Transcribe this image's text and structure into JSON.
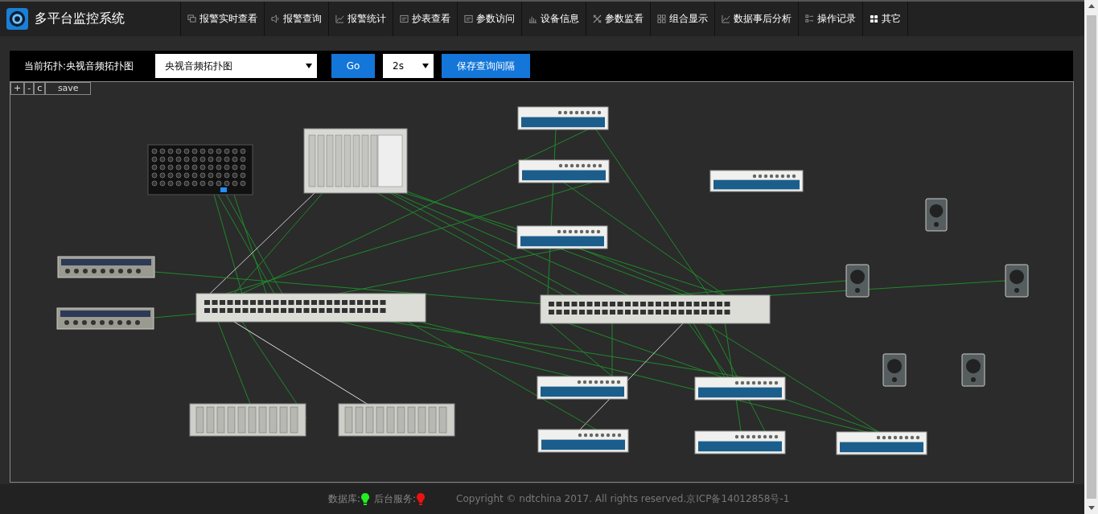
{
  "app": {
    "title": "多平台监控系统"
  },
  "nav": [
    {
      "label": "报警实时查看"
    },
    {
      "label": "报警查询"
    },
    {
      "label": "报警统计"
    },
    {
      "label": "抄表查看"
    },
    {
      "label": "参数访问"
    },
    {
      "label": "设备信息"
    },
    {
      "label": "参数监看"
    },
    {
      "label": "组合显示"
    },
    {
      "label": "数据事后分析"
    },
    {
      "label": "操作记录"
    },
    {
      "label": "其它"
    }
  ],
  "toolbar": {
    "topology_label": "当前拓扑:央视音频拓扑图",
    "topology_select": "央视音频拓扑图",
    "go_button": "Go",
    "interval_select": "2s",
    "save_interval_button": "保存查询间隔"
  },
  "canvas_controls": [
    "+",
    "-",
    "c",
    "save"
  ],
  "footer": {
    "statuses": [
      {
        "label": "数据库:",
        "color": "#22ee22"
      },
      {
        "label": "后台服务:",
        "color": "#ee1111"
      }
    ],
    "copyright": "Copyright © ndtchina 2017. All rights reserved.京ICP备14012858号-1"
  }
}
